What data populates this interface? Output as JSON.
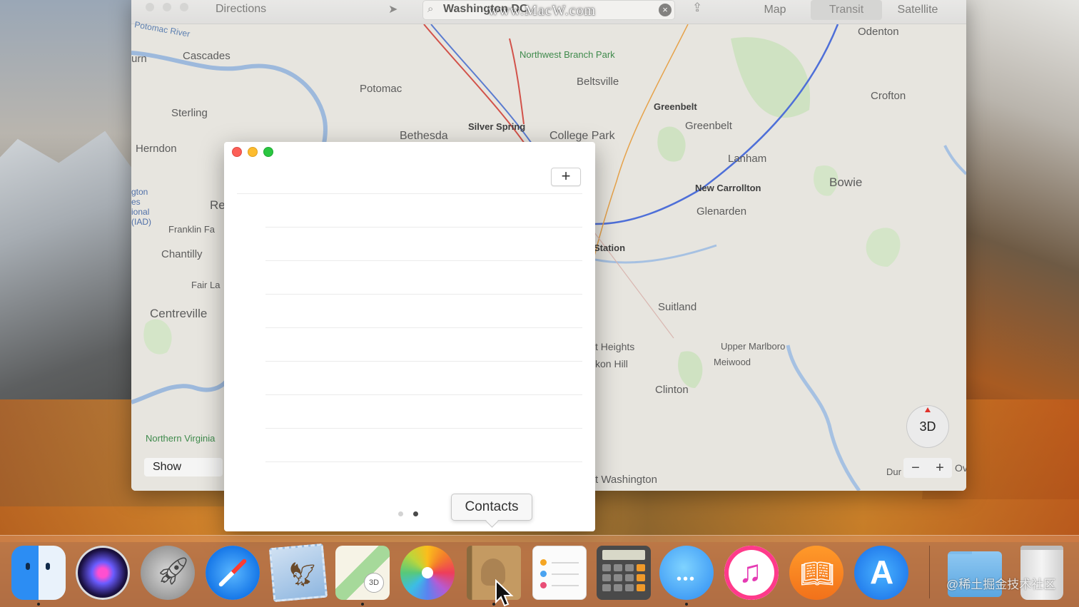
{
  "maps": {
    "toolbar": {
      "directions_label": "Directions",
      "search_value": "Washington DC",
      "view_modes": [
        "Map",
        "Transit",
        "Satellite"
      ],
      "active_view": "Transit"
    },
    "place_labels": [
      "Potomac River",
      "urn",
      "Cascades",
      "Potomac",
      "Sterling",
      "Herndon",
      "gton",
      "es",
      "ional",
      "(IAD)",
      "Re",
      "Franklin Fa",
      "Chantilly",
      "Fair La",
      "Centreville",
      "Northwest Branch Park",
      "Beltsville",
      "Silver Spring",
      "Bethesda",
      "College Park",
      "Greenbelt",
      "Greenbelt",
      "Lanham",
      "New Carrollton",
      "Glenarden",
      "Station",
      "Bowie",
      "Odenton",
      "Crofton",
      "Suitland",
      "t Heights",
      "kon Hill",
      "Upper Marlboro",
      "Meiwood",
      "Clinton",
      "t Washington",
      "Dur",
      "Northern Virginia",
      "Ov"
    ],
    "show_label": "Show",
    "compass_label": "3D",
    "zoom_out": "−",
    "zoom_in": "+"
  },
  "watermark": "www.MacW.com",
  "contacts_window": {
    "add_button": "+",
    "page_dots": 2,
    "active_page": 2
  },
  "tooltip": "Contacts",
  "dock": {
    "apps": [
      "Finder",
      "Siri",
      "Launchpad",
      "Safari",
      "Mail",
      "Maps",
      "Photos",
      "Contacts",
      "Reminders",
      "Calculator",
      "Messages",
      "iTunes",
      "iBooks",
      "App Store",
      "Downloads",
      "Trash"
    ]
  },
  "footer_watermark": "@稀土掘金技术社区"
}
